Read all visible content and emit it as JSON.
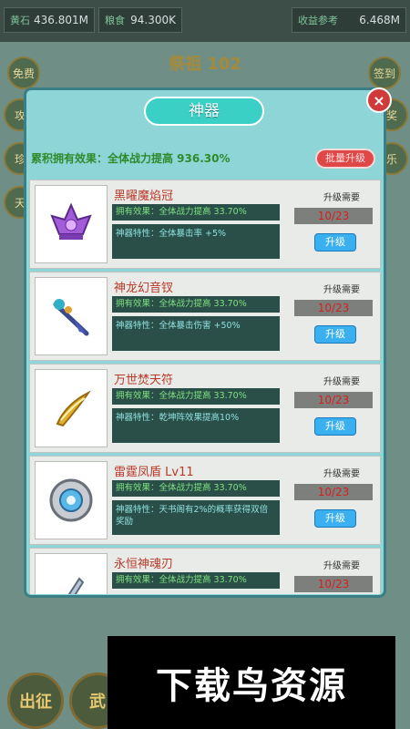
{
  "background": {
    "stats": [
      {
        "label": "黄石",
        "value": "436.801M"
      },
      {
        "label": "粮食",
        "value": "94.300K"
      },
      {
        "label": "收益参考",
        "value": "6.468M"
      }
    ],
    "level_title": "祭祖 102",
    "left_buttons": [
      "免费",
      "攻",
      "珍",
      "天"
    ],
    "right_buttons": [
      "签到",
      "奖",
      "乐"
    ],
    "bottom_buttons": [
      "出征",
      "武"
    ]
  },
  "modal": {
    "title": "神器",
    "close_symbol": "×",
    "collection_effect": "累积拥有效果：全体战力提高 936.30%",
    "bulk_upgrade_label": "批量升级",
    "items": [
      {
        "name": "黑曜魔焰冠",
        "owned_effect": "拥有效果：全体战力提高 33.70%",
        "feature": "神器特性：全体暴击率 +5%",
        "requirement_label": "升级需要",
        "requirement_value": "10/23",
        "upgrade_label": "升级",
        "icon": "purple-crown-icon"
      },
      {
        "name": "神龙幻音钗",
        "owned_effect": "拥有效果：全体战力提高 33.70%",
        "feature": "神器特性：全体暴击伤害 +50%",
        "requirement_label": "升级需要",
        "requirement_value": "10/23",
        "upgrade_label": "升级",
        "icon": "dragon-hairpin-icon"
      },
      {
        "name": "万世焚天符",
        "owned_effect": "拥有效果：全体战力提高 33.70%",
        "feature": "神器特性：乾坤阵效果提高10%",
        "requirement_label": "升级需要",
        "requirement_value": "10/23",
        "upgrade_label": "升级",
        "icon": "golden-talisman-icon"
      },
      {
        "name": "雷霆凤盾 Lv11",
        "owned_effect": "拥有效果：全体战力提高 33.70%",
        "feature": "神器特性：天书阁有2%的概率获得双倍奖励",
        "requirement_label": "升级需要",
        "requirement_value": "10/23",
        "upgrade_label": "升级",
        "icon": "phoenix-shield-icon"
      },
      {
        "name": "永恒神魂刃",
        "owned_effect": "拥有效果：全体战力提高 33.70%",
        "feature": "",
        "requirement_label": "升级需要",
        "requirement_value": "10/23",
        "upgrade_label": "",
        "icon": "soul-blade-icon"
      }
    ]
  },
  "watermark": "下载鸟资源"
}
